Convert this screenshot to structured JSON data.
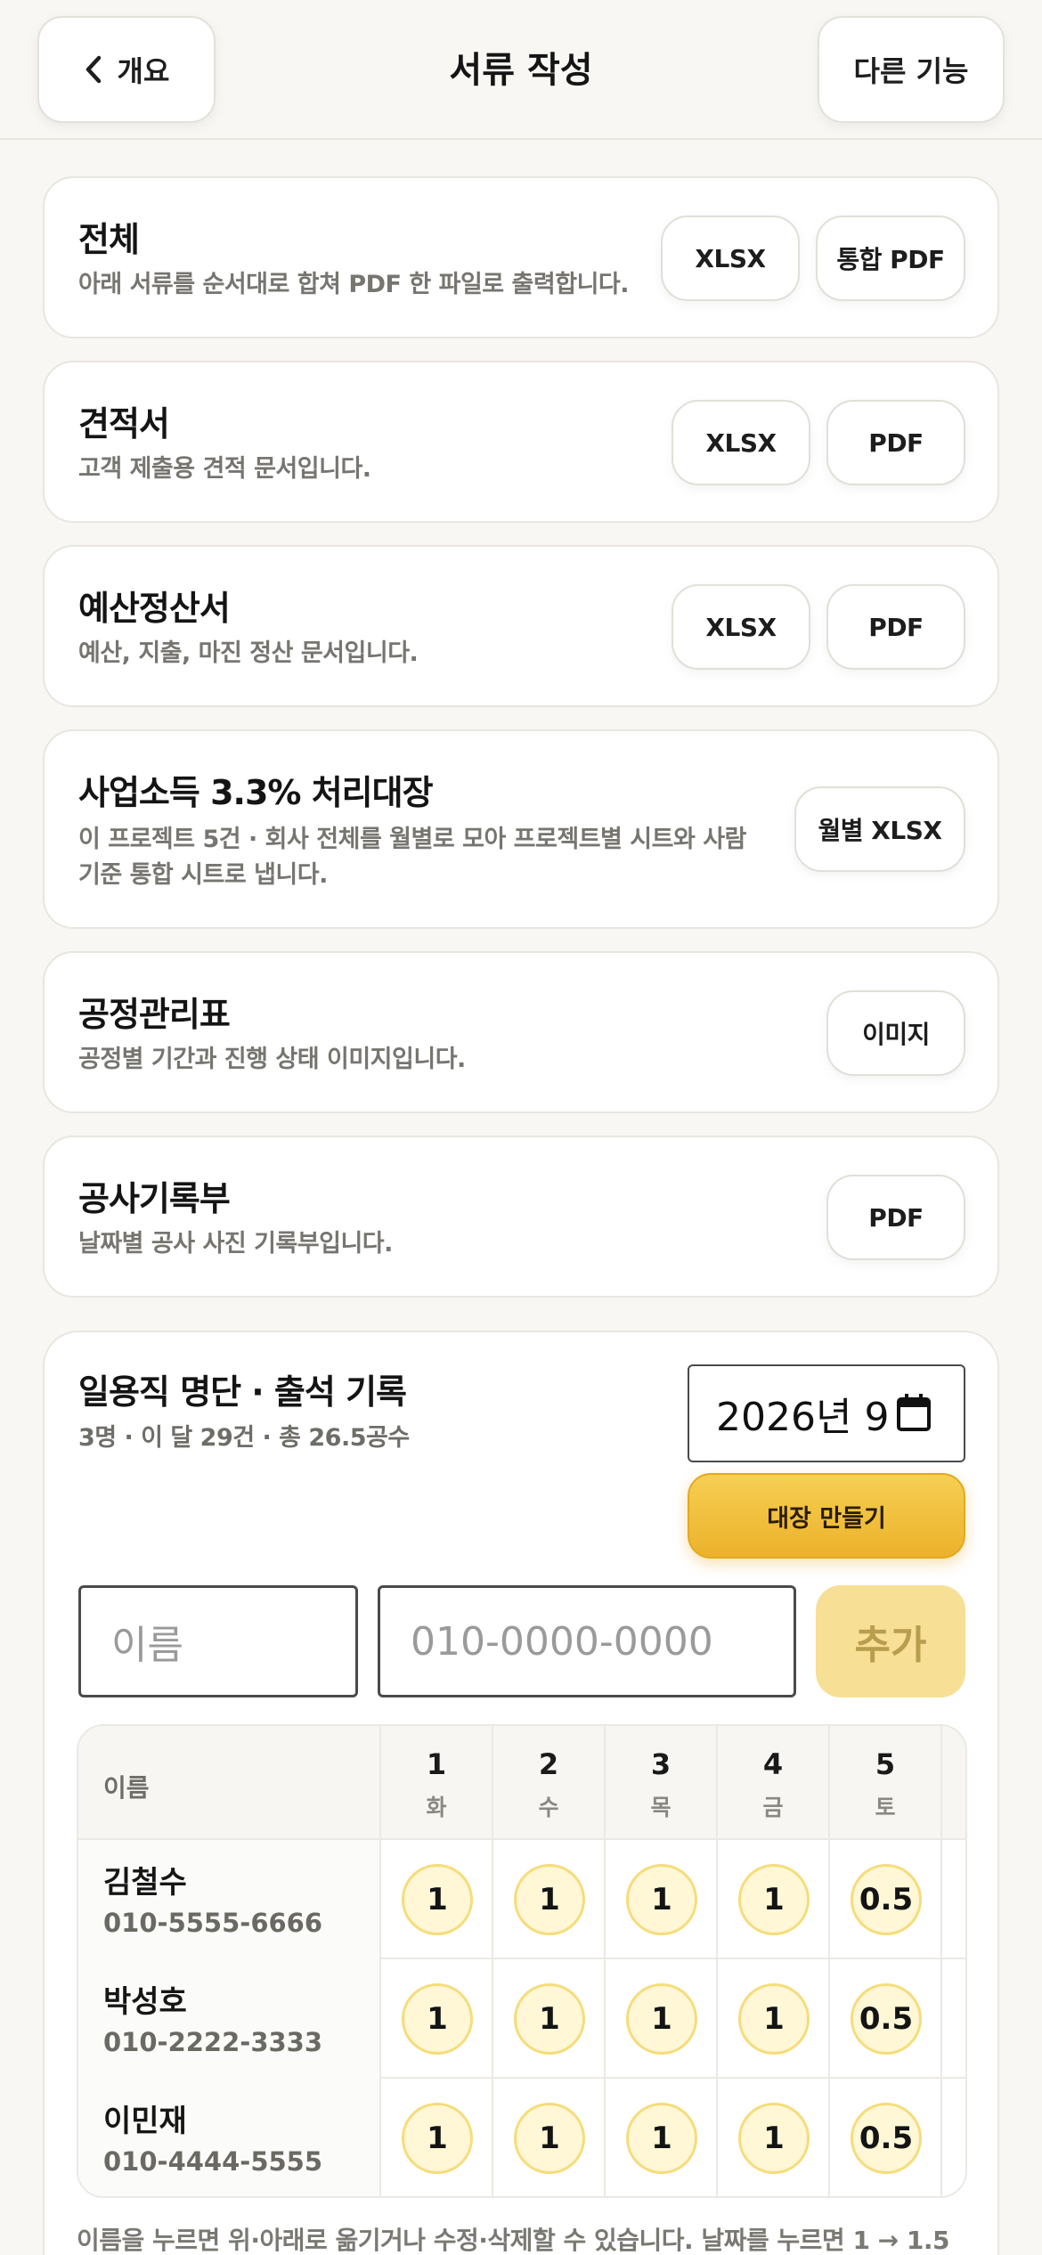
{
  "header": {
    "back_label": "개요",
    "title": "서류 작성",
    "more_label": "다른 기능"
  },
  "documents": [
    {
      "title": "전체",
      "desc": "아래 서류를 순서대로 합쳐 PDF 한 파일로 출력합니다.",
      "buttons": [
        "XLSX",
        "통합 PDF"
      ]
    },
    {
      "title": "견적서",
      "desc": "고객 제출용 견적 문서입니다.",
      "buttons": [
        "XLSX",
        "PDF"
      ]
    },
    {
      "title": "예산정산서",
      "desc": "예산, 지출, 마진 정산 문서입니다.",
      "buttons": [
        "XLSX",
        "PDF"
      ]
    },
    {
      "title": "사업소득 3.3% 처리대장",
      "desc_line1": "이 프로젝트 5건 · 회사 전체를 월별로 모아 프로젝트별 시트와 사람",
      "desc_line2": "기준 통합 시트로 냅니다.",
      "buttons": [
        "월별 XLSX"
      ]
    },
    {
      "title": "공정관리표",
      "desc": "공정별 기간과 진행 상태 이미지입니다.",
      "buttons": [
        "이미지"
      ]
    },
    {
      "title": "공사기록부",
      "desc": "날짜별 공사 사진 기록부입니다.",
      "buttons": [
        "PDF"
      ]
    }
  ],
  "attendance": {
    "title": "일용직 명단 · 출석 기록",
    "summary": "3명 · 이 달 29건 · 총 26.5공수",
    "month_value": "2026년 9",
    "make_button": "대장 만들기",
    "name_placeholder": "이름",
    "phone_placeholder": "010-0000-0000",
    "add_button": "추가",
    "table": {
      "name_header": "이름",
      "days": [
        {
          "d": "1",
          "w": "화"
        },
        {
          "d": "2",
          "w": "수"
        },
        {
          "d": "3",
          "w": "목"
        },
        {
          "d": "4",
          "w": "금"
        },
        {
          "d": "5",
          "w": "토"
        }
      ],
      "rows": [
        {
          "name": "김철수",
          "phone": "010-5555-6666",
          "values": [
            "1",
            "1",
            "1",
            "1",
            "0.5"
          ]
        },
        {
          "name": "박성호",
          "phone": "010-2222-3333",
          "values": [
            "1",
            "1",
            "1",
            "1",
            "0.5"
          ]
        },
        {
          "name": "이민재",
          "phone": "010-4444-5555",
          "values": [
            "1",
            "1",
            "1",
            "1",
            "0.5"
          ]
        }
      ]
    },
    "note": "이름을 누르면 위·아래로 옮기거나 수정·삭제할 수 있습니다. 날짜를 누르면 1 → 1.5"
  },
  "colors": {
    "accent": "#ecb22b",
    "accent_light": "#f7df95",
    "bubble_fill": "#fff7d6",
    "background": "#f8f7f3"
  },
  "icons": [
    "chevron-left-icon",
    "calendar-icon"
  ]
}
